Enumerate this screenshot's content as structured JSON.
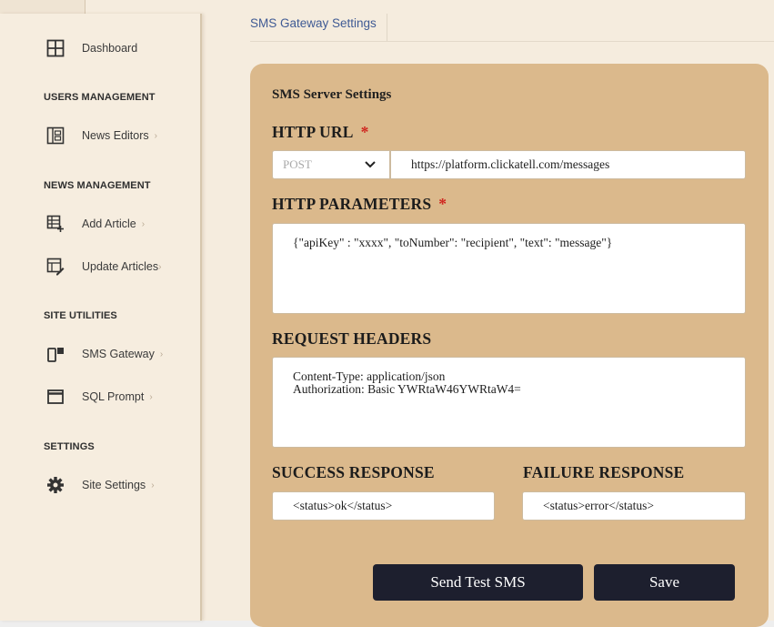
{
  "breadcrumb": {
    "current": "SMS Gateway Settings"
  },
  "sidebar": {
    "dashboard": "Dashboard",
    "sections": {
      "users": "USERS MANAGEMENT",
      "news": "NEWS MANAGEMENT",
      "utilities": "SITE UTILITIES",
      "settings": "SETTINGS"
    },
    "items": {
      "news_editors": "News Editors",
      "add_article": "Add Article",
      "update_articles": "Update Articles",
      "sms_gateway": "SMS Gateway",
      "sql_prompt": "SQL Prompt",
      "site_settings": "Site Settings"
    },
    "chevron": "›"
  },
  "form": {
    "title": "SMS Server Settings",
    "http_url": {
      "label": "HTTP URL",
      "required": "*",
      "method": "POST",
      "value": "https://platform.clickatell.com/messages"
    },
    "http_params": {
      "label": "HTTP PARAMETERS",
      "required": "*",
      "value": "{\"apiKey\" : \"xxxx\", \"toNumber\": \"recipient\", \"text\": \"message\"}"
    },
    "request_headers": {
      "label": "REQUEST HEADERS",
      "value": "Content-Type: application/json\nAuthorization: Basic YWRtaW46YWRtaW4="
    },
    "success": {
      "label": "SUCCESS RESPONSE",
      "value": "<status>ok</status>"
    },
    "failure": {
      "label": "FAILURE RESPONSE",
      "value": "<status>error</status>"
    },
    "buttons": {
      "test": "Send Test SMS",
      "save": "Save"
    }
  },
  "colors": {
    "card": "#dbb98c",
    "button": "#1d1f2e",
    "link": "#3f5a94",
    "required": "#d0261f"
  }
}
